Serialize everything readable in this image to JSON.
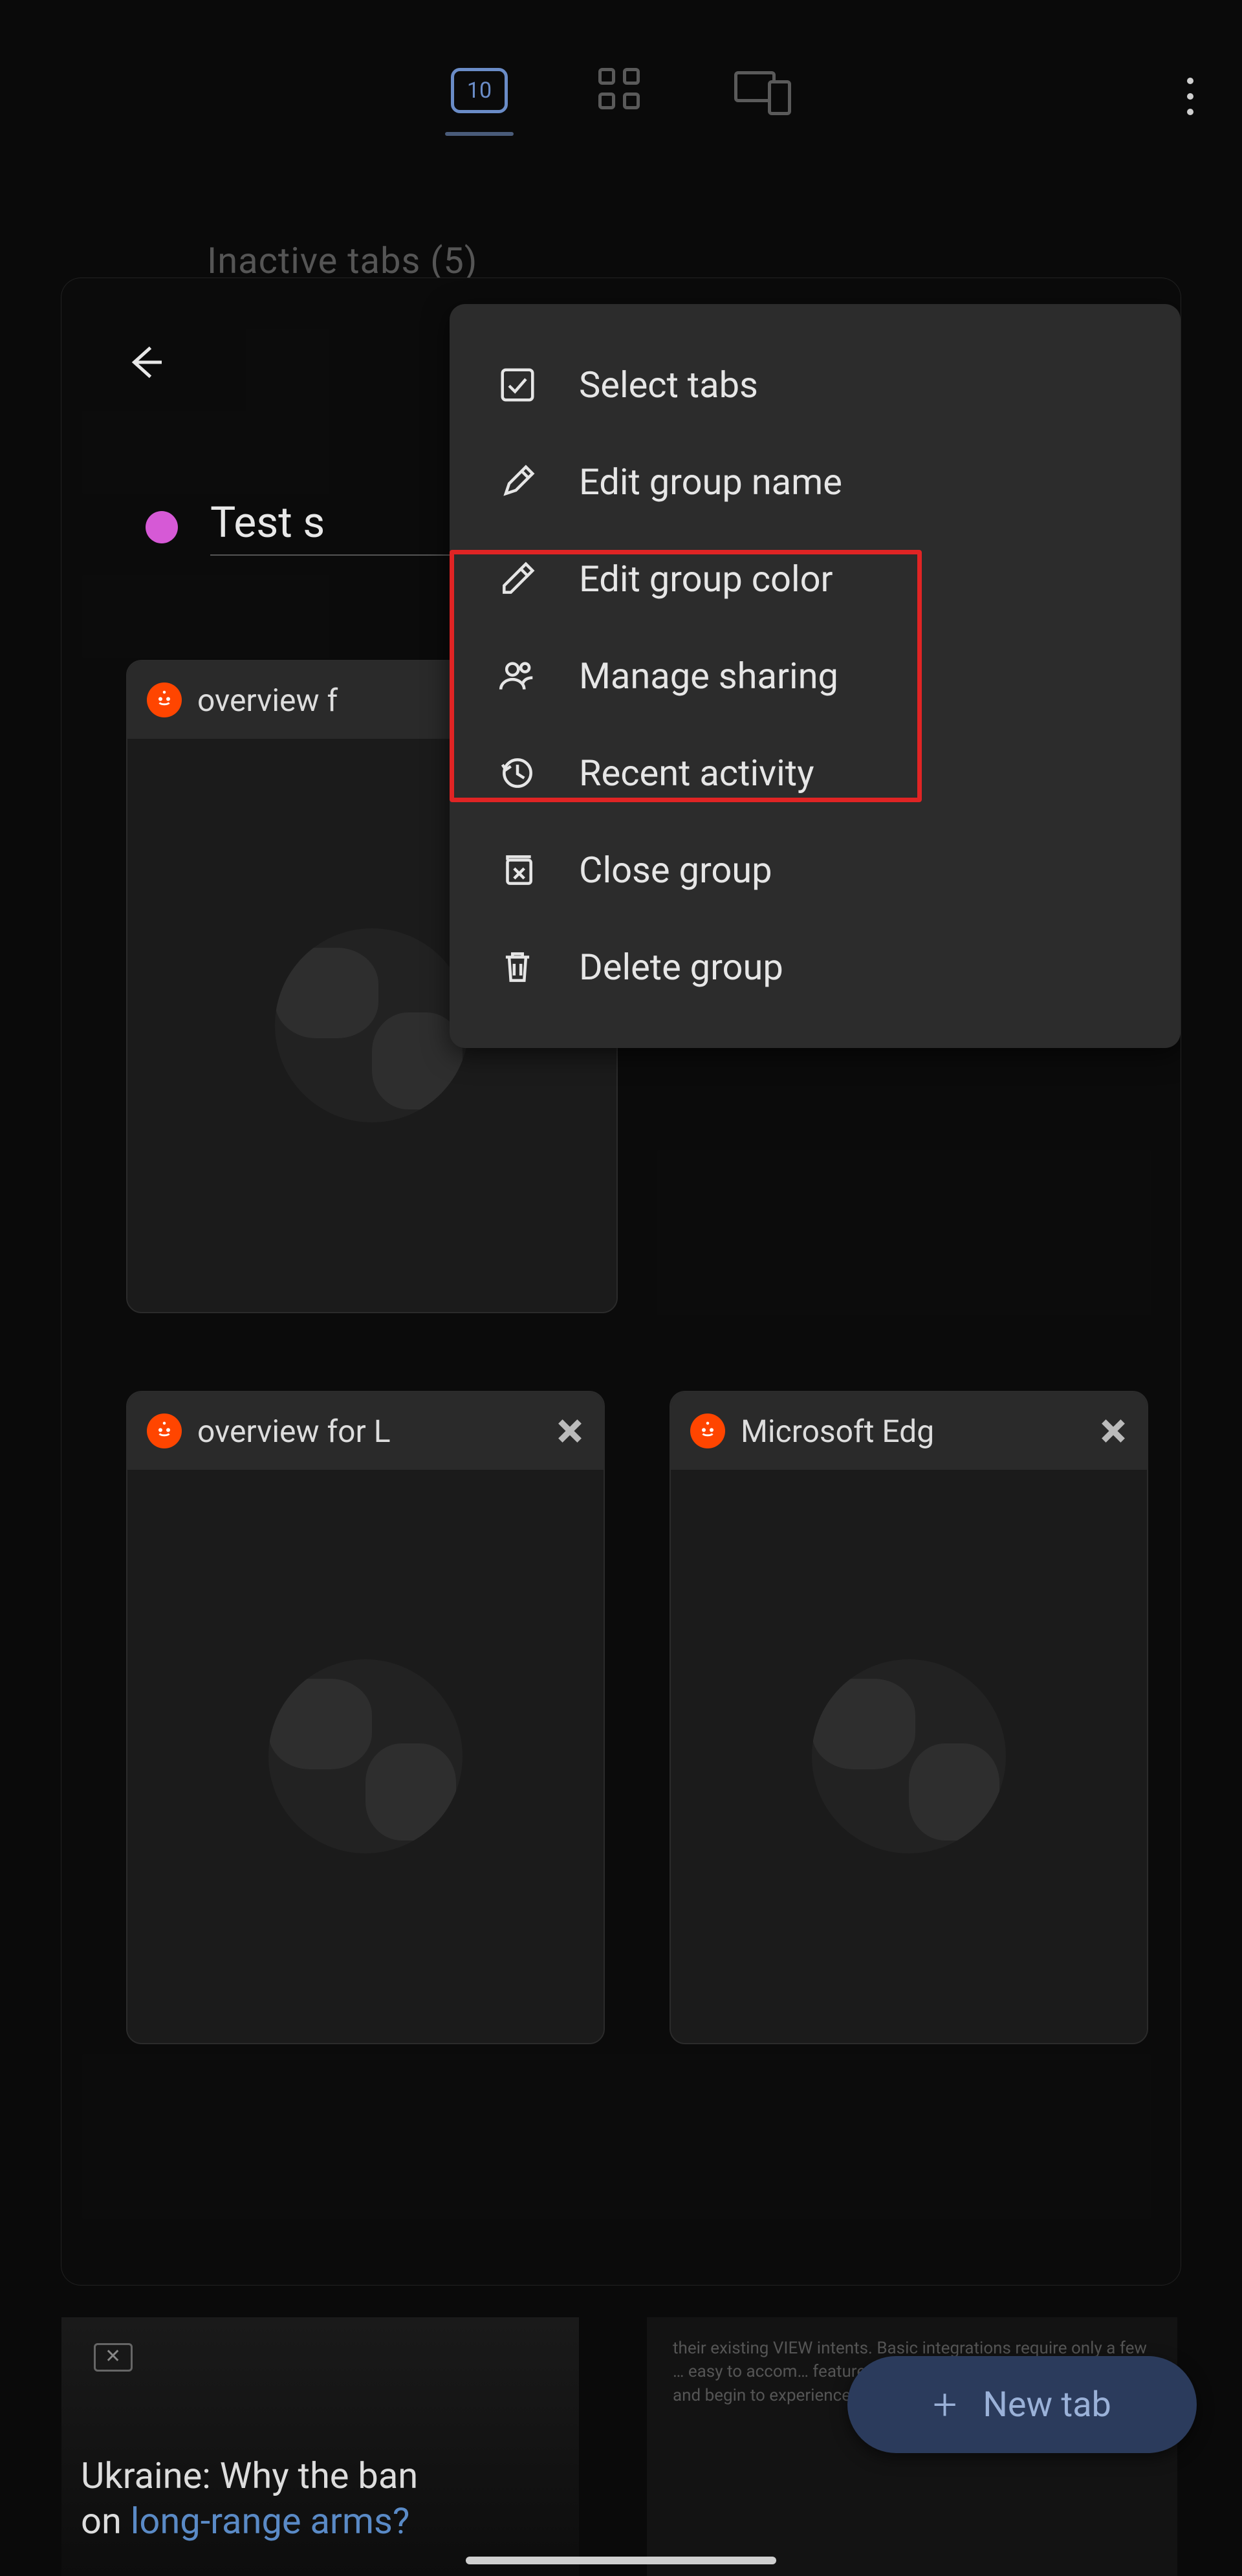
{
  "topbar": {
    "tab_count": "10"
  },
  "inactive_tabs_label": "Inactive tabs (5)",
  "group": {
    "name_prefix": "Test s",
    "color": "#d659d6"
  },
  "menu": {
    "items": [
      {
        "label": "Select tabs",
        "icon": "check-box-icon"
      },
      {
        "label": "Edit group name",
        "icon": "pencil-icon"
      },
      {
        "label": "Edit group color",
        "icon": "eyedropper-icon"
      },
      {
        "label": "Manage sharing",
        "icon": "people-icon"
      },
      {
        "label": "Recent activity",
        "icon": "history-icon"
      },
      {
        "label": "Close group",
        "icon": "close-box-stack-icon"
      },
      {
        "label": "Delete group",
        "icon": "trash-icon"
      }
    ]
  },
  "tabs": [
    {
      "title": "overview f",
      "favicon": "reddit"
    },
    {
      "title": "overview for L",
      "favicon": "reddit"
    },
    {
      "title": "Microsoft Edg",
      "favicon": "reddit"
    }
  ],
  "background_left": {
    "headline_a": "Ukraine: Why the ban",
    "headline_b": "on ",
    "headline_link": "long-range arms?"
  },
  "background_right": {
    "blurb": "their existing VIEW intents. Basic integrations require only a few … easy to accom… feature of Chro… Android where … available … and begin to experience custom tabs in the"
  },
  "new_tab_label": "New tab"
}
